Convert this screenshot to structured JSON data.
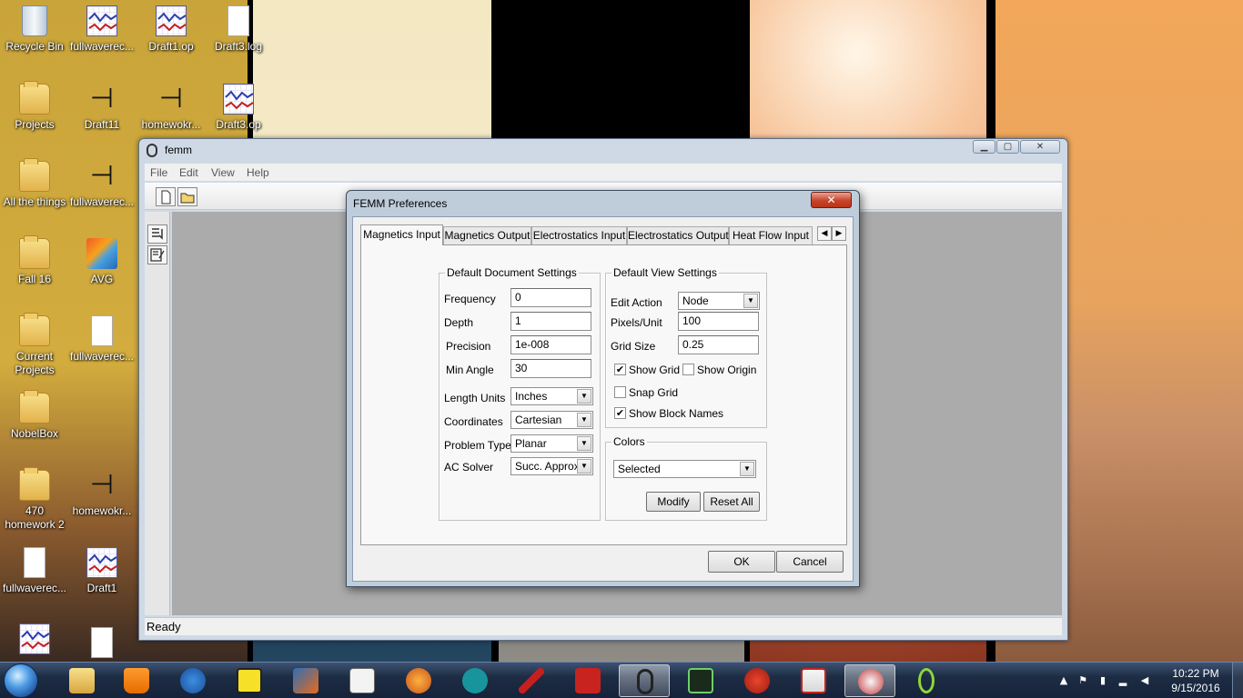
{
  "desktop": {
    "icons": [
      {
        "label": "Recycle Bin",
        "icon": "recycle-bin-icon"
      },
      {
        "label": "fullwaverec...",
        "icon": "plot-file-icon"
      },
      {
        "label": "Draft1.op",
        "icon": "plot-file-icon"
      },
      {
        "label": "Draft3.log",
        "icon": "document-icon"
      },
      {
        "label": "Projects",
        "icon": "folder-icon"
      },
      {
        "label": "Draft11",
        "icon": "transistor-icon"
      },
      {
        "label": "homewokr...",
        "icon": "transistor-icon"
      },
      {
        "label": "Draft3.op",
        "icon": "plot-file-icon"
      },
      {
        "label": "All the things",
        "icon": "folder-icon"
      },
      {
        "label": "fullwaverec...",
        "icon": "transistor-icon"
      },
      {
        "label": "Fall 16",
        "icon": "folder-icon"
      },
      {
        "label": "AVG",
        "icon": "avg-icon"
      },
      {
        "label": "Current Projects",
        "icon": "folder-icon"
      },
      {
        "label": "fullwaverec...",
        "icon": "document-icon"
      },
      {
        "label": "NobelBox",
        "icon": "folder-icon"
      },
      {
        "label": "470 homework 2",
        "icon": "folder-icon"
      },
      {
        "label": "homewokr...",
        "icon": "transistor-icon"
      },
      {
        "label": "fullwaverec...",
        "icon": "document-icon"
      },
      {
        "label": "Draft1",
        "icon": "plot-file-icon"
      },
      {
        "label": "",
        "icon": "plot-file-icon"
      },
      {
        "label": "",
        "icon": "document-icon"
      }
    ]
  },
  "femm": {
    "title": "femm",
    "menu": [
      "File",
      "Edit",
      "View",
      "Help"
    ],
    "toolbar_icons": [
      "new-document-icon",
      "open-folder-icon"
    ],
    "status": "Ready"
  },
  "dialog": {
    "title": "FEMM Preferences",
    "close_glyph": "✕",
    "tabs": [
      "Magnetics Input",
      "Magnetics Output",
      "Electrostatics Input",
      "Electrostatics Output",
      "Heat Flow Input"
    ],
    "active_tab": "Magnetics Input",
    "doc_settings": {
      "title": "Default Document Settings",
      "frequency_label": "Frequency",
      "frequency": "0",
      "depth_label": "Depth",
      "depth": "1",
      "precision_label": "Precision",
      "precision": "1e-008",
      "min_angle_label": "Min Angle",
      "min_angle": "30",
      "length_units_label": "Length Units",
      "length_units": "Inches",
      "coordinates_label": "Coordinates",
      "coordinates": "Cartesian",
      "problem_type_label": "Problem Type",
      "problem_type": "Planar",
      "ac_solver_label": "AC Solver",
      "ac_solver": "Succ. Approx"
    },
    "view_settings": {
      "title": "Default View Settings",
      "edit_action_label": "Edit Action",
      "edit_action": "Node",
      "pixels_unit_label": "Pixels/Unit",
      "pixels_unit": "100",
      "grid_size_label": "Grid Size",
      "grid_size": "0.25",
      "show_grid_label": "Show Grid",
      "show_grid": true,
      "show_origin_label": "Show Origin",
      "show_origin": false,
      "snap_grid_label": "Snap Grid",
      "snap_grid": false,
      "show_block_names_label": "Show Block Names",
      "show_block_names": true
    },
    "colors": {
      "title": "Colors",
      "selected": "Selected",
      "modify_label": "Modify",
      "reset_label": "Reset All"
    },
    "ok_label": "OK",
    "cancel_label": "Cancel"
  },
  "taskbar": {
    "apps": [
      "file-explorer-icon",
      "vlc-icon",
      "firefox-icon",
      "sign-icon",
      "matlab-icon",
      "document-icon",
      "math-icon",
      "arduino-icon",
      "ltspice-icon",
      "solidworks-icon",
      "femm-icon",
      "scope-icon",
      "ccleaner-icon",
      "eagle-icon",
      "snipping-tool-icon",
      "app-icon"
    ],
    "active_app": "femm-icon",
    "time": "10:22 PM",
    "date": "9/15/2016"
  }
}
